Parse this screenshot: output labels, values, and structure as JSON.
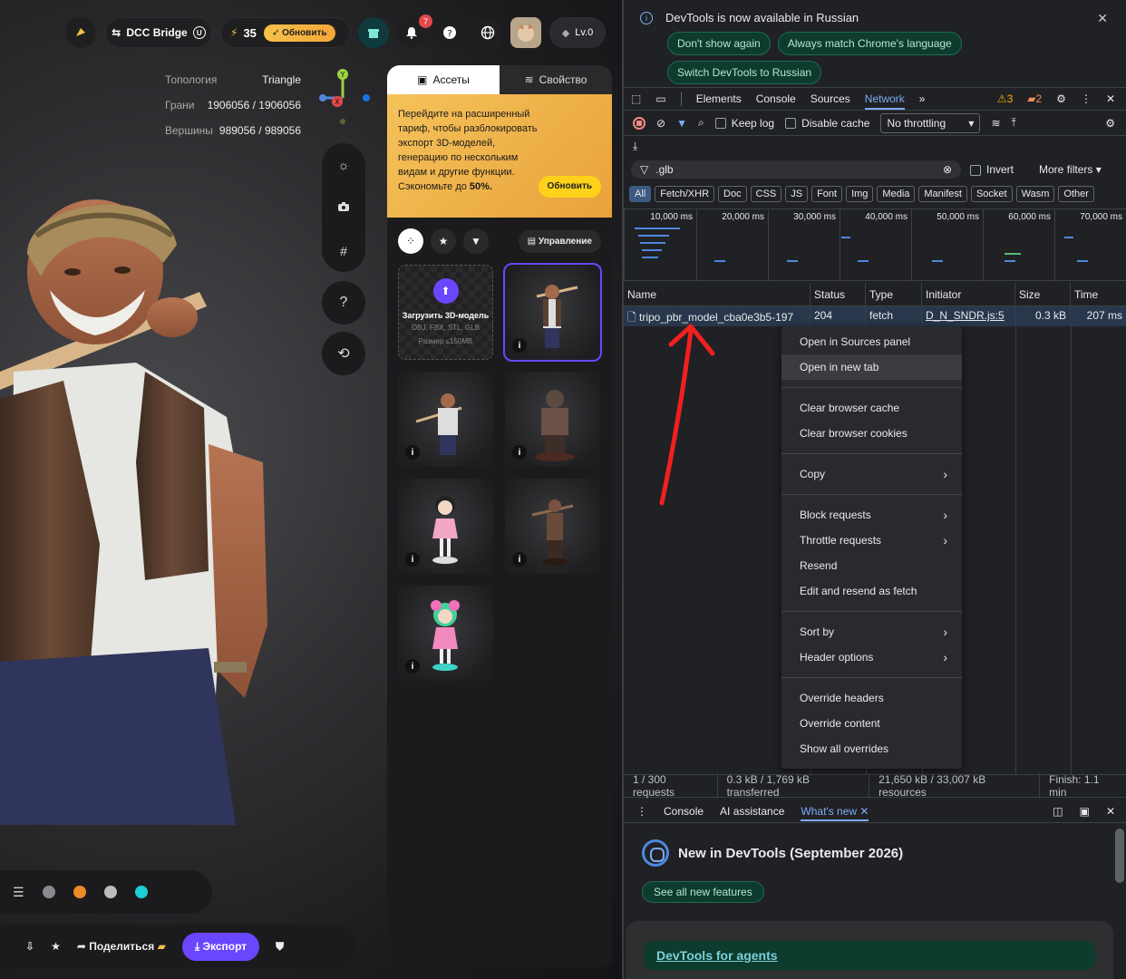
{
  "app": {
    "topbar": {
      "dcc_label": "DCC Bridge",
      "credits": "35",
      "upgrade_label": "Обновить",
      "notifications": "7",
      "level": "Lv.0"
    },
    "stats": [
      {
        "label": "Топология",
        "value": "Triangle"
      },
      {
        "label": "Грани",
        "value": "1906056 / 1906056"
      },
      {
        "label": "Вершины",
        "value": "989056 / 989056"
      }
    ],
    "axis_labels": {
      "y": "Y",
      "x": "X"
    },
    "bottom": {
      "share_label": "Поделиться",
      "export_label": "Экспорт"
    },
    "material_colors": [
      "#d040d0",
      "#8a8a8e",
      "#f08a24",
      "#bdbdbd",
      "#1ccfd6"
    ],
    "panel": {
      "tab_assets": "Ассеты",
      "tab_props": "Свойство",
      "promo_text": "Перейдите на расширенный тариф, чтобы разблокировать экспорт 3D-моделей, генерацию по нескольким видам и другие функции. Сэкономьте до ",
      "promo_pct": "50%.",
      "promo_btn": "Обновить",
      "manage_label": "Управление",
      "upload_title": "Загрузить 3D-модель",
      "upload_formats": "OBJ, FBX, STL, GLB",
      "upload_size": "Размер ≤150MB",
      "info_glyph": "i"
    }
  },
  "devtools": {
    "notice": {
      "title": "DevTools is now available in Russian",
      "btn1": "Don't show again",
      "btn2": "Always match Chrome's language",
      "btn3": "Switch DevTools to Russian"
    },
    "tabs": [
      "Elements",
      "Console",
      "Sources",
      "Network"
    ],
    "warn_count": "3",
    "issue_count": "2",
    "toolbar": {
      "keep_log": "Keep log",
      "disable_cache": "Disable cache",
      "throttling": "No throttling"
    },
    "filter": {
      "value": ".glb",
      "invert": "Invert",
      "more": "More filters"
    },
    "types": [
      "All",
      "Fetch/XHR",
      "Doc",
      "CSS",
      "JS",
      "Font",
      "Img",
      "Media",
      "Manifest",
      "Socket",
      "Wasm",
      "Other"
    ],
    "timeline_ticks": [
      "10,000 ms",
      "20,000 ms",
      "30,000 ms",
      "40,000 ms",
      "50,000 ms",
      "60,000 ms",
      "70,000 ms"
    ],
    "columns": [
      "Name",
      "Status",
      "Type",
      "Initiator",
      "Size",
      "Time"
    ],
    "row": {
      "name": "tripo_pbr_model_cba0e3b5-197",
      "status": "204",
      "type": "fetch",
      "initiator": "D_N_SNDR.js:5",
      "size": "0.3 kB",
      "time": "207 ms"
    },
    "status": [
      "1 / 300 requests",
      "0.3 kB / 1,769 kB transferred",
      "21,650 kB / 33,007 kB resources",
      "Finish: 1.1 min"
    ],
    "drawer_tabs": [
      "Console",
      "AI assistance",
      "What's new"
    ],
    "whatsnew": {
      "title": "New in DevTools (September 2026)",
      "see_all": "See all new features",
      "agents": "DevTools for agents"
    },
    "menu": [
      [
        {
          "label": "Open in Sources panel"
        },
        {
          "label": "Open in new tab",
          "hover": true
        }
      ],
      [
        {
          "label": "Clear browser cache"
        },
        {
          "label": "Clear browser cookies"
        }
      ],
      [
        {
          "label": "Copy",
          "sub": true
        }
      ],
      [
        {
          "label": "Block requests",
          "sub": true
        },
        {
          "label": "Throttle requests",
          "sub": true
        },
        {
          "label": "Resend"
        },
        {
          "label": "Edit and resend as fetch"
        }
      ],
      [
        {
          "label": "Sort by",
          "sub": true
        },
        {
          "label": "Header options",
          "sub": true
        }
      ],
      [
        {
          "label": "Override headers"
        },
        {
          "label": "Override content"
        },
        {
          "label": "Show all overrides"
        }
      ]
    ]
  }
}
